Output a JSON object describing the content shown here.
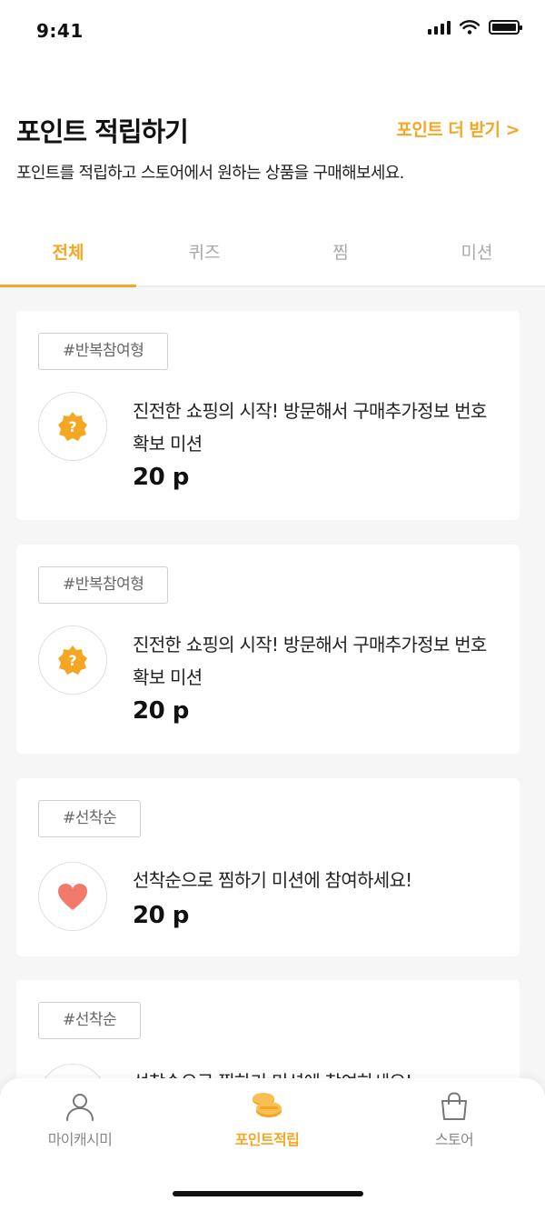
{
  "status_bar": {
    "time": "9:41"
  },
  "header": {
    "title": "포인트 적립하기",
    "more_link": "포인트 더 받기 >",
    "subtitle": "포인트를 적립하고 스토어에서 원하는 상품을 구매해보세요."
  },
  "tabs": [
    {
      "label": "전체",
      "active": true
    },
    {
      "label": "퀴즈",
      "active": false
    },
    {
      "label": "찜",
      "active": false
    },
    {
      "label": "미션",
      "active": false
    }
  ],
  "missions": [
    {
      "tag": "#반복참여형",
      "icon": "question-badge-icon",
      "text": "진전한 쇼핑의 시작! 방문해서 구매추가정보 번호 확보 미션",
      "points": "20 p"
    },
    {
      "tag": "#반복참여형",
      "icon": "question-badge-icon",
      "text": "진전한 쇼핑의 시작! 방문해서 구매추가정보 번호 확보 미션",
      "points": "20 p"
    },
    {
      "tag": "#선착순",
      "icon": "heart-icon",
      "text": "선착순으로 찜하기 미션에 참여하세요!",
      "points": "20 p"
    },
    {
      "tag": "#선착순",
      "icon": "heart-icon",
      "text": "선착순으로 찜하기 미션에 참여하세요!",
      "points": ""
    }
  ],
  "bottom_nav": [
    {
      "label": "마이캐시미",
      "icon": "person-icon",
      "active": false
    },
    {
      "label": "포인트적립",
      "icon": "coins-icon",
      "active": true
    },
    {
      "label": "스토어",
      "icon": "shopping-bag-icon",
      "active": false
    }
  ],
  "colors": {
    "accent": "#f5a623",
    "heart": "#f27a6a",
    "background": "#f6f6f6"
  }
}
